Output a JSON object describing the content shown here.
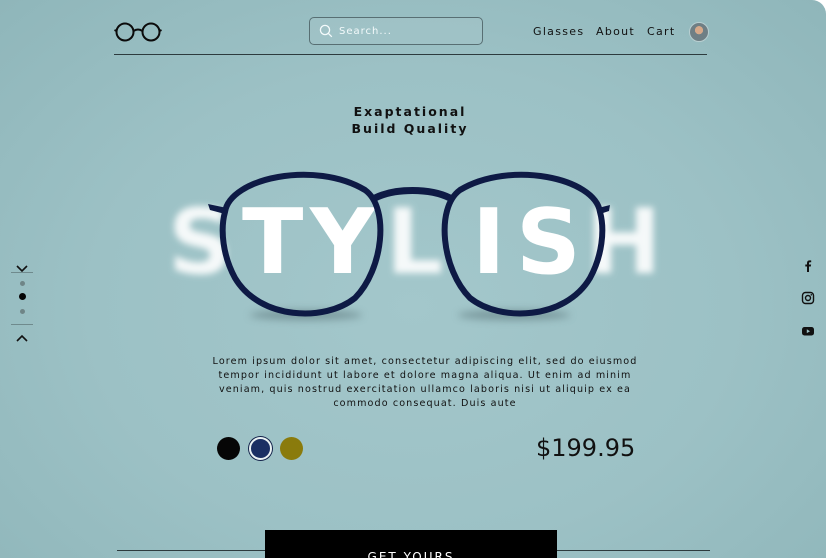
{
  "header": {
    "search_placeholder": "Search...",
    "nav": {
      "glasses": "Glasses",
      "about": "About",
      "cart": "Cart"
    }
  },
  "hero": {
    "tagline_line1": "Exaptational",
    "tagline_line2": "Build Quality",
    "headline_letters": [
      "S",
      "T",
      "Y",
      "L",
      "I",
      "S",
      "H"
    ],
    "description": "Lorem ipsum dolor sit amet, consectetur adipiscing elit, sed do eiusmod tempor incididunt ut labore et dolore magna aliqua. Ut enim ad minim veniam, quis nostrud exercitation ullamco laboris nisi ut aliquip ex ea commodo consequat. Duis aute"
  },
  "product": {
    "color_options": [
      "#060606",
      "#1a2f63",
      "#8a7b0c"
    ],
    "selected_color_index": 1,
    "price": "$199.95",
    "cta_label": "GET YOURS"
  },
  "pager": {
    "slide_count": 3,
    "active_slide_index": 1
  },
  "social": [
    "facebook-icon",
    "instagram-icon",
    "youtube-icon"
  ],
  "colors": {
    "frame": "#0e1a45",
    "background": "#9cc1c5",
    "cta": "#000000"
  }
}
